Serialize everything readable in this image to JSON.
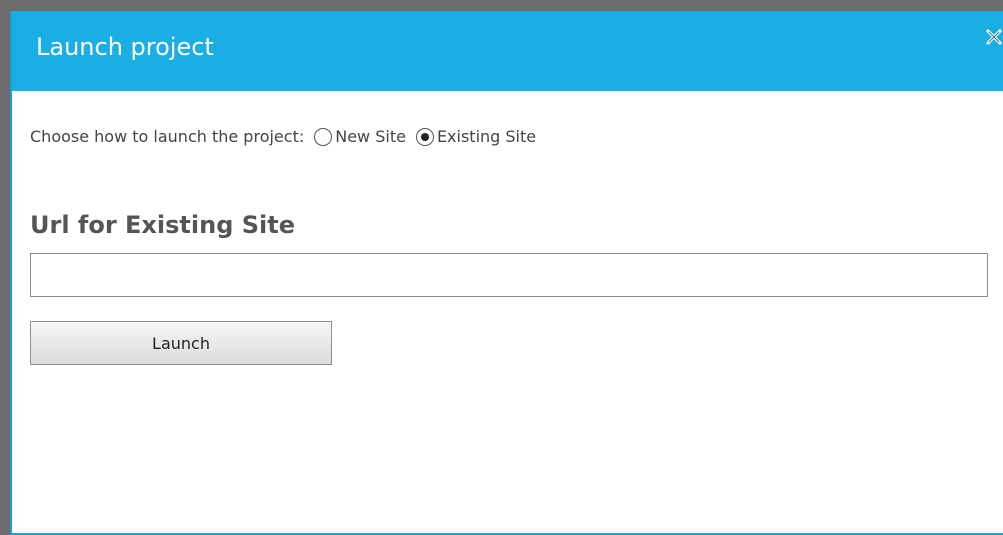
{
  "dialog": {
    "title": "Launch project",
    "close_icon": "close-icon",
    "accent_color": "#1aaee5"
  },
  "launch_mode": {
    "prompt": "Choose how to launch the project:",
    "options": [
      {
        "label": "New Site",
        "checked": false
      },
      {
        "label": "Existing Site",
        "checked": true
      }
    ]
  },
  "existing_site": {
    "heading": "Url for Existing Site",
    "url_value": "",
    "url_placeholder": ""
  },
  "actions": {
    "launch_label": "Launch"
  }
}
